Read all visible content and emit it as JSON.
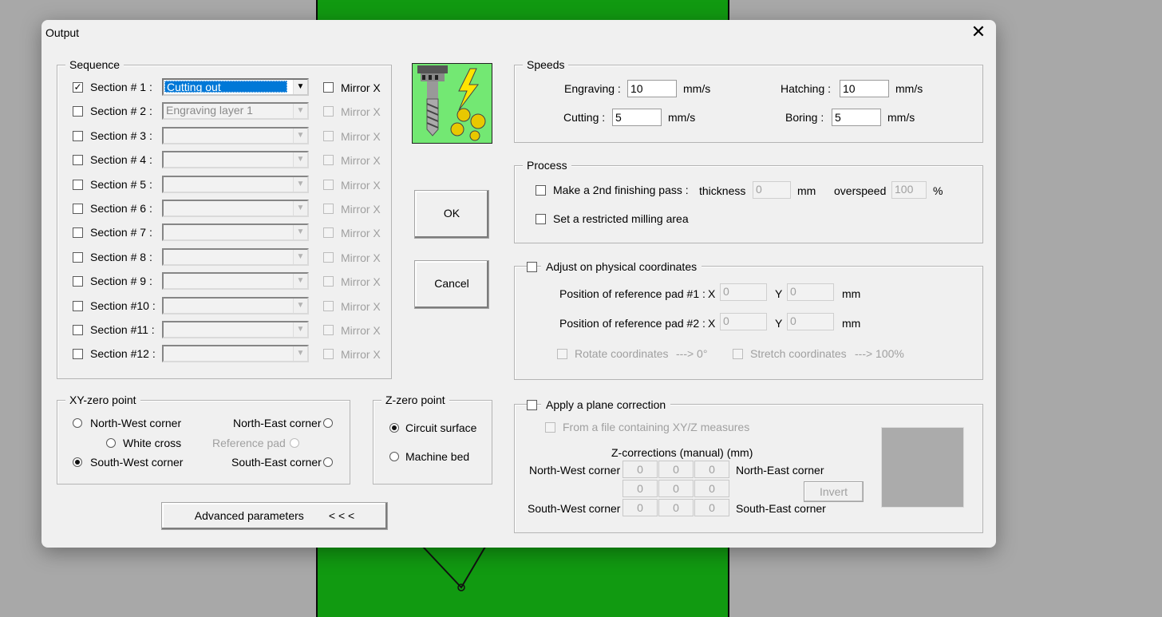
{
  "window": {
    "title": "Output",
    "close_symbol": "✕"
  },
  "sequence": {
    "legend": "Sequence",
    "mirror_label": "Mirror X",
    "rows": [
      {
        "label": "Section # 1 :",
        "checked": true,
        "value": "Cutting out",
        "enabled": true
      },
      {
        "label": "Section # 2 :",
        "checked": false,
        "value": "Engraving layer 1",
        "enabled": false
      },
      {
        "label": "Section # 3 :",
        "checked": false,
        "value": "",
        "enabled": false
      },
      {
        "label": "Section # 4 :",
        "checked": false,
        "value": "",
        "enabled": false
      },
      {
        "label": "Section # 5 :",
        "checked": false,
        "value": "",
        "enabled": false
      },
      {
        "label": "Section # 6 :",
        "checked": false,
        "value": "",
        "enabled": false
      },
      {
        "label": "Section # 7 :",
        "checked": false,
        "value": "",
        "enabled": false
      },
      {
        "label": "Section # 8 :",
        "checked": false,
        "value": "",
        "enabled": false
      },
      {
        "label": "Section # 9 :",
        "checked": false,
        "value": "",
        "enabled": false
      },
      {
        "label": "Section #10 :",
        "checked": false,
        "value": "",
        "enabled": false
      },
      {
        "label": "Section #11 :",
        "checked": false,
        "value": "",
        "enabled": false
      },
      {
        "label": "Section #12 :",
        "checked": false,
        "value": "",
        "enabled": false
      }
    ]
  },
  "buttons": {
    "ok": "OK",
    "cancel": "Cancel",
    "advanced": "Advanced parameters        < < <"
  },
  "speeds": {
    "legend": "Speeds",
    "engraving_label": "Engraving :",
    "engraving_value": "10",
    "hatching_label": "Hatching :",
    "hatching_value": "10",
    "cutting_label": "Cutting :",
    "cutting_value": "5",
    "boring_label": "Boring :",
    "boring_value": "5",
    "unit": "mm/s"
  },
  "process": {
    "legend": "Process",
    "finishing_label": "Make a 2nd finishing pass :",
    "thickness_label": "thickness",
    "thickness_value": "0",
    "thickness_unit": "mm",
    "overspeed_label": "overspeed",
    "overspeed_value": "100",
    "overspeed_unit": "%",
    "restricted_label": "Set a restricted milling area"
  },
  "physical": {
    "legend": "Adjust on physical coordinates",
    "pad1_label": "Position of reference pad #1 :",
    "pad2_label": "Position of reference pad #2 :",
    "x_label": "X",
    "y_label": "Y",
    "unit": "mm",
    "pad1_x": "0",
    "pad1_y": "0",
    "pad2_x": "0",
    "pad2_y": "0",
    "rotate_label": "Rotate coordinates",
    "rotate_value": "---> 0°",
    "stretch_label": "Stretch coordinates",
    "stretch_value": "---> 100%"
  },
  "xyzero": {
    "legend": "XY-zero point",
    "nw": "North-West corner",
    "ne": "North-East corner",
    "white_cross": "White cross",
    "ref_pad": "Reference pad",
    "sw": "South-West corner",
    "se": "South-East corner",
    "selected": "sw"
  },
  "zzero": {
    "legend": "Z-zero point",
    "surface": "Circuit surface",
    "bed": "Machine bed",
    "selected": "surface"
  },
  "plane": {
    "legend": "Apply a plane correction",
    "from_file": "From a file containing XY/Z measures",
    "zcorr_title": "Z-corrections (manual) (mm)",
    "nw": "North-West corner",
    "ne": "North-East corner",
    "sw": "South-West corner",
    "se": "South-East corner",
    "invert": "Invert",
    "grid": [
      [
        "0",
        "0",
        "0"
      ],
      [
        "0",
        "0",
        "0"
      ],
      [
        "0",
        "0",
        "0"
      ]
    ]
  },
  "colors": {
    "selection": "#0078d7",
    "background_board": "#119a11",
    "preview": "#ababab"
  },
  "icons": {
    "tool": "milling-bit-lightning-gears-icon"
  }
}
